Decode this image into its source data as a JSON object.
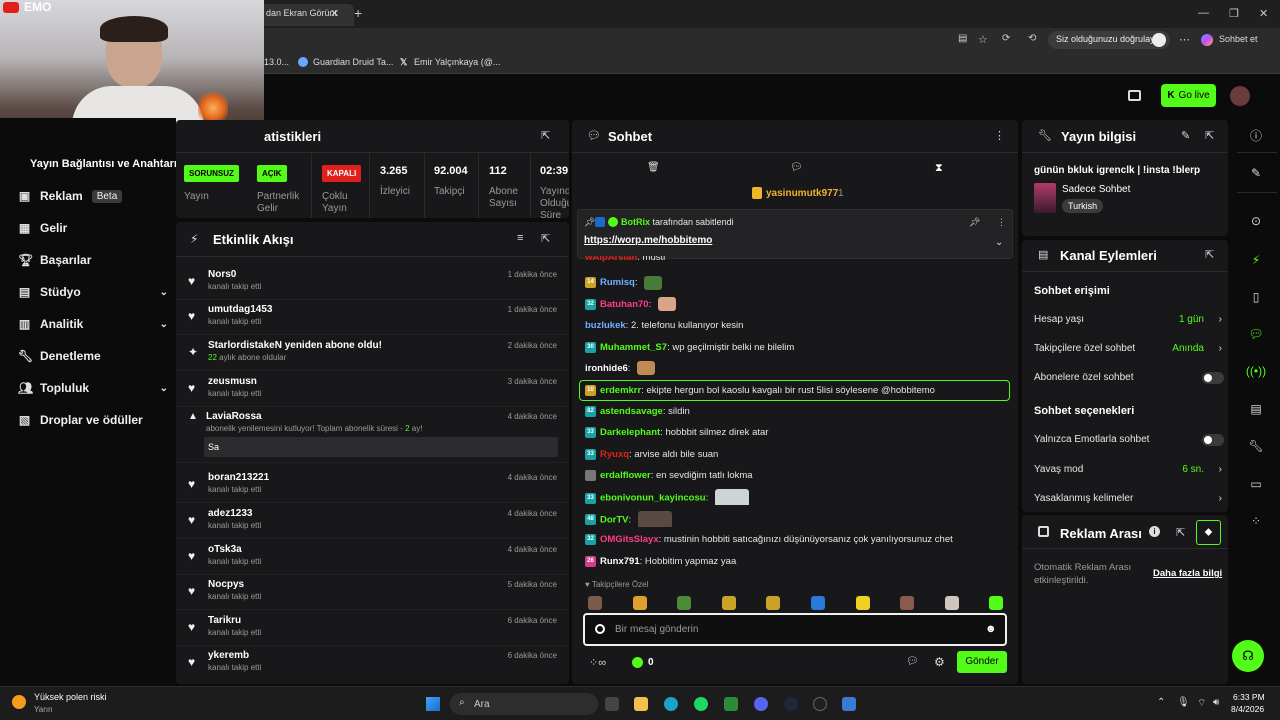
{
  "browser": {
    "tab_title": "dan Ekran Görünt",
    "verify_label": "Siz olduğunuzu doğrulayın",
    "chat_button": "Sohbet et",
    "bookmarks": [
      "13.0...",
      "Guardian Druid Ta...",
      "Emir Yalçınkaya (@..."
    ]
  },
  "webcam": {
    "label": "EMO"
  },
  "header": {
    "go_live": "Go live"
  },
  "sidebar": {
    "title": "Yayın Bağlantısı ve Anahtarı",
    "items": [
      {
        "label": "Reklam",
        "badge": "Beta",
        "icon": "ad-icon"
      },
      {
        "label": "Gelir",
        "icon": "revenue-icon"
      },
      {
        "label": "Başarılar",
        "icon": "trophy-icon"
      },
      {
        "label": "Stüdyo",
        "icon": "studio-icon",
        "expand": true
      },
      {
        "label": "Analitik",
        "icon": "analytics-icon",
        "expand": true
      },
      {
        "label": "Denetleme",
        "icon": "wrench-icon"
      },
      {
        "label": "Topluluk",
        "icon": "community-icon",
        "expand": true
      },
      {
        "label": "Droplar ve ödüller",
        "icon": "drops-icon"
      }
    ]
  },
  "stats": {
    "title": "atistikleri",
    "items": [
      {
        "badge": "SORUNSUZ",
        "label": "Yayın",
        "color": "#53fc18"
      },
      {
        "badge": "AÇIK",
        "label": "Partnerlik Gelir",
        "color": "#53fc18"
      },
      {
        "badge": "KAPALI",
        "label": "Çoklu Yayın",
        "color": "#e0201b"
      },
      {
        "value": "3.265",
        "label": "İzleyici"
      },
      {
        "value": "92.004",
        "label": "Takipçi"
      },
      {
        "value": "112",
        "label": "Abone Sayısı"
      },
      {
        "value": "02:39:",
        "label": "Yayında Olduğu Süre"
      }
    ]
  },
  "activity": {
    "title": "Etkinlik Akışı",
    "events": [
      {
        "name": "Nors0",
        "sub": "kanalı takip etti",
        "time": "1 dakika önce",
        "icon": "heart"
      },
      {
        "name": "umutdag1453",
        "sub": "kanalı takip etti",
        "time": "1 dakika önce",
        "icon": "heart"
      },
      {
        "name": "StarlordistakeN yeniden abone oldu!",
        "sub_prefix": "22",
        "sub": " aylık abone oldular",
        "time": "2 dakika önce",
        "icon": "star"
      },
      {
        "name": "zeusmusn",
        "sub": "kanalı takip etti",
        "time": "3 dakika önce",
        "icon": "heart"
      },
      {
        "name": "LaviaRossa",
        "sub": "abonelik yenilemesini kutluyor! Toplam abonelik süresi - ",
        "sub_suffix": "2",
        "sub_tail": " ay!",
        "message": "Sa",
        "time": "4 dakika önce",
        "icon": "party"
      },
      {
        "name": "boran213221",
        "sub": "kanalı takip etti",
        "time": "4 dakika önce",
        "icon": "heart"
      },
      {
        "name": "adez1233",
        "sub": "kanalı takip etti",
        "time": "4 dakika önce",
        "icon": "heart"
      },
      {
        "name": "oTsk3a",
        "sub": "kanalı takip etti",
        "time": "4 dakika önce",
        "icon": "heart"
      },
      {
        "name": "Nocpys",
        "sub": "kanalı takip etti",
        "time": "5 dakika önce",
        "icon": "heart"
      },
      {
        "name": "Tarikru",
        "sub": "kanalı takip etti",
        "time": "6 dakika önce",
        "icon": "heart"
      },
      {
        "name": "ykeremb",
        "sub": "kanalı takip etti",
        "time": "6 dakika önce",
        "icon": "heart"
      }
    ]
  },
  "chat": {
    "title": "Sohbet",
    "top_gifter": "yasinumutk977",
    "top_gifter_count": "1",
    "pinned_by": "BotRix",
    "pinned_by_suffix": "tarafından sabitlendi",
    "pinned_link": "https://worp.me/hobbitemo",
    "messages": [
      {
        "user": "wAlpArslan",
        "color": "#e0201b",
        "text": "musti",
        "badge": ""
      },
      {
        "user": "Rumisq",
        "color": "#6fb0ff",
        "text": "",
        "badge": "14",
        "badge_color": "#c9a227",
        "emote": "#4a7a3a"
      },
      {
        "user": "Batuhan70",
        "color": "#ff3c8a",
        "text": "",
        "badge": "32",
        "badge_color": "#1aa3a3",
        "emote": "#d9a38a"
      },
      {
        "user": "buzlukek",
        "color": "#6fb0ff",
        "text": "2. telefonu kullanıyor kesin",
        "badge": ""
      },
      {
        "user": "Muhammet_S7",
        "color": "#53fc18",
        "text": "wp geçilmiştir belki ne bilelim",
        "badge": "30",
        "badge_color": "#1aa3a3"
      },
      {
        "user": "ironhide6",
        "color": "#ffffff",
        "text": "",
        "badge": "",
        "emote": "#c08a55"
      },
      {
        "user": "erdemkrr",
        "color": "#53fc18",
        "text": "ekipte hergun bol kaoslu kavgalı bir rust 5lisi söylesene @hobbitemo",
        "badge": "10",
        "badge_color": "#c9a227",
        "highlight": true
      },
      {
        "user": "astendsavage",
        "color": "#53fc18",
        "text": "sildin",
        "badge": "82",
        "badge_color": "#1aa3a3"
      },
      {
        "user": "Darkelephant",
        "color": "#53fc18",
        "text": "hobbbit silmez direk atar",
        "badge": "33",
        "badge_color": "#1aa3a3"
      },
      {
        "user": "Ryuxq",
        "color": "#e0201b",
        "text": "arvise aldı bile suan",
        "badge": "33",
        "badge_color": "#1aa3a3"
      },
      {
        "user": "erdalflower",
        "color": "#53fc18",
        "text": "en sevdiğim tatlı lokma",
        "badge": "",
        "badge_color": "#777"
      },
      {
        "user": "ebonivonun_kayincosu",
        "color": "#53fc18",
        "text": "",
        "badge": "33",
        "badge_color": "#1aa3a3",
        "emote": "#cfd4d8"
      },
      {
        "user": "DorTV",
        "color": "#53fc18",
        "text": "",
        "badge": "48",
        "badge_color": "#1aa3a3",
        "emote": "#5a4a44"
      },
      {
        "user": "OMGitsSlayx",
        "color": "#ff3c8a",
        "text": "mustinin hobbiti satıcağınızı düşünüyorsanız çok yanılıyorsunuz chet",
        "badge": "32",
        "badge_color": "#1aa3a3"
      },
      {
        "user": "Runx791",
        "color": "#ffffff",
        "text": "Hobbitim yapmaz yaa",
        "badge": "26",
        "badge_color": "#d63a8a"
      }
    ],
    "followers_only": "Takipçilere Özel",
    "input_placeholder": "Bir mesaj gönderin",
    "points": "0",
    "send_label": "Gönder"
  },
  "stream_info": {
    "title": "Yayın bilgisi",
    "stream_title": "günün bkluk igrenclk | !insta !blerp",
    "category": "Sadece Sohbet",
    "tag": "Turkish"
  },
  "channel_actions": {
    "title": "Kanal Eylemleri",
    "chat_access": "Sohbet erişimi",
    "rows": [
      {
        "label": "Hesap yaşı",
        "value": "1 gün",
        "type": "chevron"
      },
      {
        "label": "Takipçilere özel sohbet",
        "value": "Anında",
        "type": "chevron"
      },
      {
        "label": "Abonelere özel sohbet",
        "type": "toggle"
      }
    ],
    "chat_options": "Sohbet seçenekleri",
    "rows2": [
      {
        "label": "Yalnızca Emotlarla sohbet",
        "type": "toggle"
      },
      {
        "label": "Yavaş mod",
        "value": "6 sn.",
        "type": "chevron"
      },
      {
        "label": "Yasaklanmış kelimeler",
        "type": "chevron"
      }
    ]
  },
  "ad_break": {
    "title": "Reklam Arası",
    "text": "Otomatik Reklam Arası etkinleştirildi.",
    "link": "Daha fazla bilgi"
  },
  "taskbar": {
    "weather_title": "Yüksek polen riski",
    "weather_sub": "Yarın",
    "search": "Ara",
    "time": "6:33 PM",
    "date": "8/4/2026"
  },
  "colors": {
    "accent": "#53fc18",
    "panel": "#18181a",
    "bg": "#0b0b0c"
  }
}
